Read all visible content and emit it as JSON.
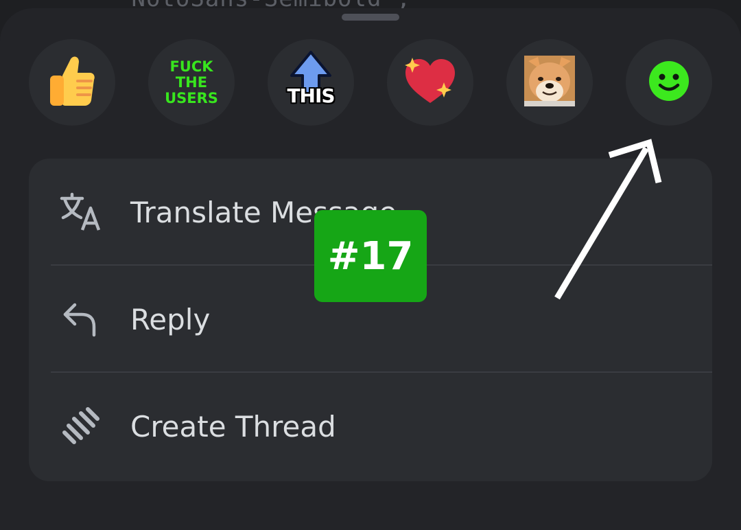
{
  "background": {
    "code_text": "\"NotoSans-Semibold\";"
  },
  "reactions": [
    {
      "name": "thumbs-up",
      "icon": "thumbs-up-icon"
    },
    {
      "name": "fuck-the-users",
      "lines": [
        "FUCK",
        "THE",
        "USERS"
      ],
      "color": "#38e61e"
    },
    {
      "name": "this-upvote",
      "label": "THIS",
      "color": "#5b8def"
    },
    {
      "name": "sparkling-heart",
      "icon": "sparkling-heart-icon",
      "color": "#dd2e44"
    },
    {
      "name": "doge",
      "icon": "doge-icon"
    },
    {
      "name": "add-reaction",
      "icon": "add-reaction-icon",
      "color": "#3ce81e"
    }
  ],
  "menu": {
    "items": [
      {
        "label": "Translate Message",
        "icon": "translate-icon"
      },
      {
        "label": "Reply",
        "icon": "reply-icon"
      },
      {
        "label": "Create Thread",
        "icon": "thread-icon"
      }
    ]
  },
  "annotation": {
    "badge_label": "#17",
    "badge_color": "#16a616"
  }
}
